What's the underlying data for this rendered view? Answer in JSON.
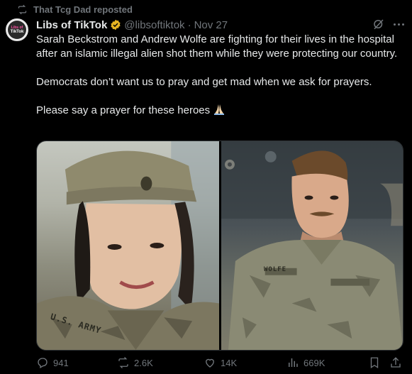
{
  "repost": {
    "icon": "repost-icon",
    "text": "That Tcg Dad reposted"
  },
  "author": {
    "avatar_text_line1": "Libs of",
    "avatar_text_line2": "TikTok",
    "name": "Libs of TikTok",
    "verified_color": "#e6b422",
    "handle": "@libsoftiktok",
    "separator": "·",
    "date": "Nov 27"
  },
  "tweet": {
    "paragraphs": [
      "Sarah Beckstrom and Andrew Wolfe are fighting for their lives in the hospital after an islamic illegal alien shot them while they were protecting our country.",
      "Democrats don’t want us to pray and get mad when we ask for prayers."
    ],
    "last_line": "Please say a prayer for these heroes",
    "emoji": "folded-hands"
  },
  "media": {
    "left_photo_name_tape": "U.S. ARMY",
    "right_photo_name_tape": "WOLFE"
  },
  "actions": {
    "replies": "941",
    "reposts": "2.6K",
    "likes": "14K",
    "views": "669K"
  },
  "colors": {
    "background": "#000000",
    "text": "#e7e9ea",
    "muted": "#71767b",
    "border": "#2f3336"
  }
}
